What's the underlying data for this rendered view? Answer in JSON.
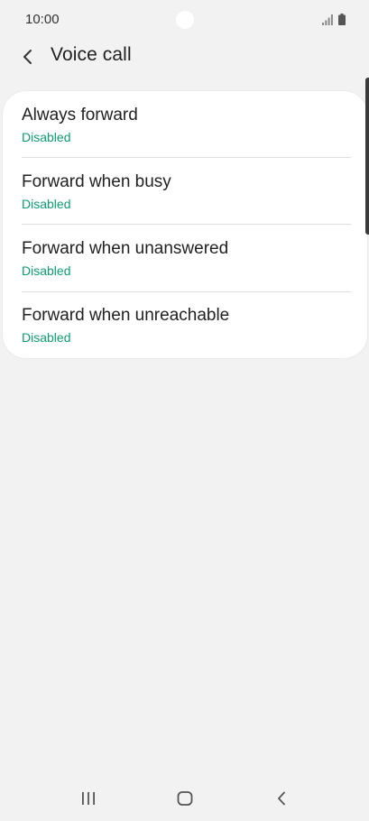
{
  "status_bar": {
    "time": "10:00",
    "signal_icon": "signal-icon",
    "battery_icon": "battery-icon"
  },
  "header": {
    "back_icon": "chevron-left-icon",
    "title": "Voice call"
  },
  "forwarding_options": [
    {
      "title": "Always forward",
      "status": "Disabled"
    },
    {
      "title": "Forward when busy",
      "status": "Disabled"
    },
    {
      "title": "Forward when unanswered",
      "status": "Disabled"
    },
    {
      "title": "Forward when unreachable",
      "status": "Disabled"
    }
  ],
  "nav_bar": {
    "recents_icon": "recents-icon",
    "home_icon": "home-icon",
    "back_icon": "back-icon"
  },
  "colors": {
    "background": "#f2f2f2",
    "card": "#ffffff",
    "status_text": "#0f9d70",
    "title_text": "#222222"
  }
}
